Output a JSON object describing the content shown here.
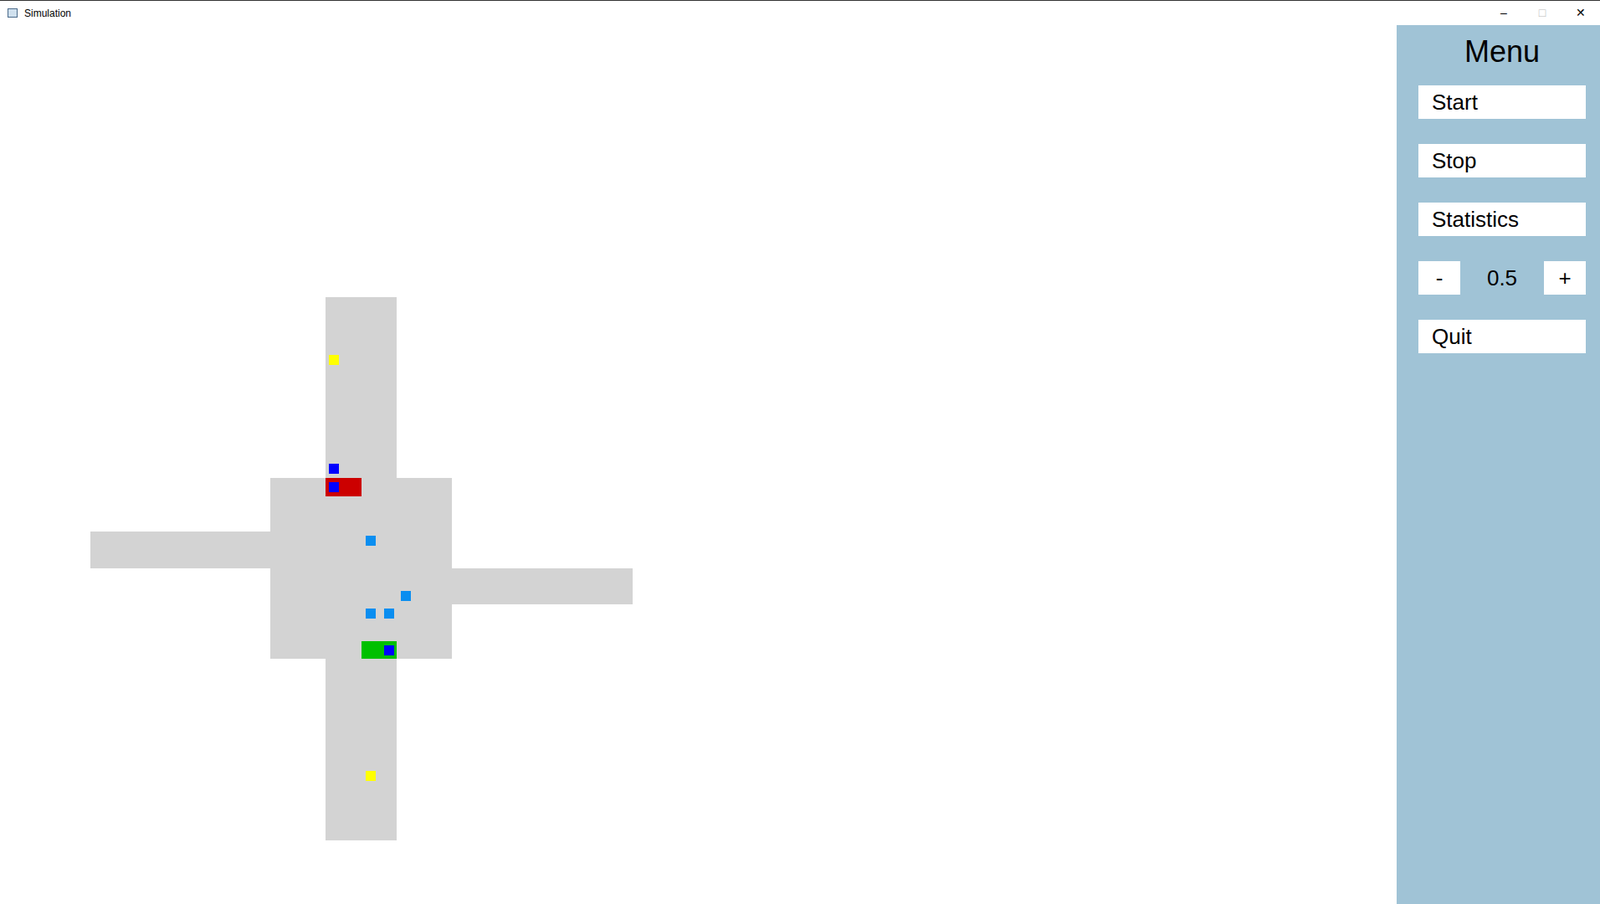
{
  "window": {
    "title": "Simulation",
    "controls": [
      "–",
      "□",
      "✕"
    ]
  },
  "menu": {
    "title": "Menu",
    "buttons": [
      "Start",
      "Stop",
      "Statistics"
    ],
    "speed": {
      "decrease": "-",
      "value": "0.5",
      "increase": "+"
    },
    "quit": "Quit"
  },
  "traffic_lights": [
    {
      "name": "north-light",
      "state": "red",
      "color": "#cc0000"
    },
    {
      "name": "south-light",
      "state": "green",
      "color": "#00c000"
    }
  ],
  "vehicles": [
    {
      "color": "#ffff00"
    },
    {
      "color": "#ffff00"
    },
    {
      "color": "#0000ff"
    },
    {
      "color": "#0000ff"
    },
    {
      "color": "#0000ff"
    },
    {
      "color": "#0a8ef0"
    },
    {
      "color": "#0a8ef0"
    },
    {
      "color": "#0a8ef0"
    },
    {
      "color": "#0a8ef0"
    }
  ]
}
